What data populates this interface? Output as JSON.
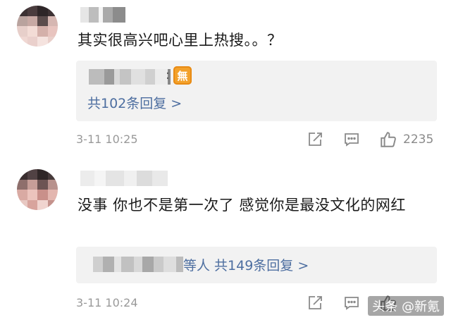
{
  "comments": [
    {
      "text": "其实很高兴吧心里上热搜。。？",
      "reply_summary": "共102条回复 >",
      "reply_badge": "無",
      "reply_separator": ":",
      "timestamp": "3-11 10:25",
      "likes": "2235",
      "icons": [
        "share-icon",
        "comment-icon",
        "like-icon"
      ]
    },
    {
      "text": "没事 你也不是第一次了 感觉你是最没文化的网红",
      "reply_summary": "等人 共149条回复 >",
      "timestamp": "3-11 10:24",
      "likes": "",
      "icons": [
        "share-icon",
        "comment-icon",
        "like-icon"
      ]
    }
  ],
  "watermark": "头条 @新氪",
  "colors": {
    "link": "#4d6ea0",
    "meta": "#999999",
    "reply_bg": "#f2f2f2",
    "badge": "#f3a12b"
  }
}
